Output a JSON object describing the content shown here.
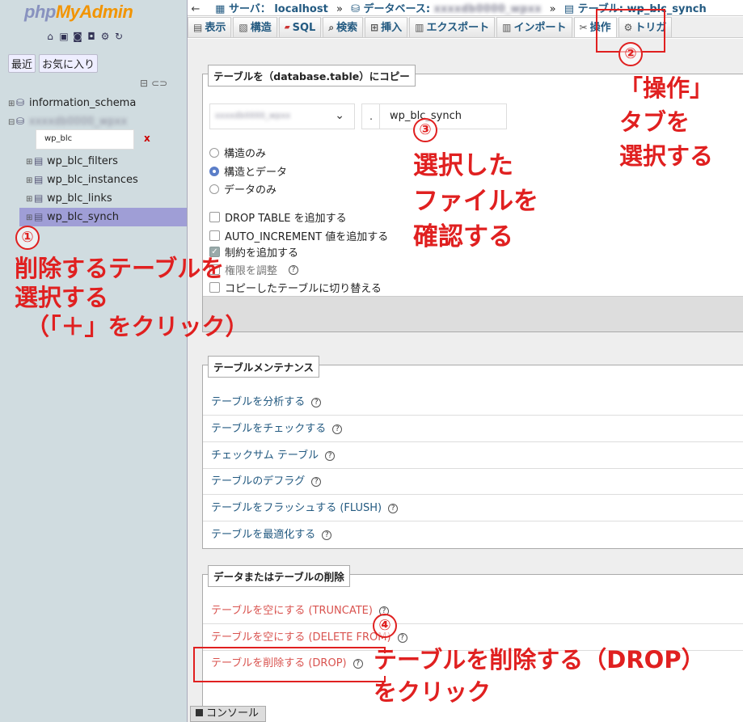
{
  "nav": {
    "logo_php": "php",
    "logo_myadmin": "MyAdmin",
    "tab_recent": "最近",
    "tab_favorites": "お気に入り",
    "databases": [
      {
        "name": "information_schema"
      },
      {
        "name": "xxxxdb0000_wpxx"
      }
    ],
    "filter_value": "wp_blc",
    "filter_clear": "x",
    "tables": [
      "wp_blc_filters",
      "wp_blc_instances",
      "wp_blc_links",
      "wp_blc_synch"
    ]
  },
  "breadcrumb": {
    "server_label": "サーバ： localhost",
    "db_label": "データベース:",
    "db_name": "xxxxdb0000_wpxx",
    "table_label": "テーブル: wp_blc_synch"
  },
  "tabs": [
    {
      "label": "表示",
      "icon": "browse-icon"
    },
    {
      "label": "構造",
      "icon": "structure-icon"
    },
    {
      "label": "SQL",
      "icon": "sql-icon"
    },
    {
      "label": "検索",
      "icon": "search-icon"
    },
    {
      "label": "挿入",
      "icon": "insert-icon"
    },
    {
      "label": "エクスポート",
      "icon": "export-icon"
    },
    {
      "label": "インポート",
      "icon": "import-icon"
    },
    {
      "label": "操作",
      "icon": "operations-icon"
    },
    {
      "label": "トリガ",
      "icon": "triggers-icon"
    }
  ],
  "copy_panel": {
    "legend": "テーブルを（database.table）にコピー",
    "db_value": "xxxxdb0000_wpxx",
    "dot": ".",
    "table_value": "wp_blc_synch",
    "radios": [
      {
        "label": "構造のみ",
        "checked": false
      },
      {
        "label": "構造とデータ",
        "checked": true
      },
      {
        "label": "データのみ",
        "checked": false
      }
    ],
    "checks": [
      {
        "label": "DROP TABLE を追加する",
        "checked": false
      },
      {
        "label": "AUTO_INCREMENT 値を追加する",
        "checked": false
      },
      {
        "label": "制約を追加する",
        "checked": true
      },
      {
        "label": "権限を調整",
        "checked": false
      },
      {
        "label": "コピーしたテーブルに切り替える",
        "checked": false
      }
    ],
    "help": "?"
  },
  "maintenance": {
    "legend": "テーブルメンテナンス",
    "links": [
      "テーブルを分析する",
      "テーブルをチェックする",
      "チェックサム テーブル",
      "テーブルのデフラグ",
      "テーブルをフラッシュする (FLUSH)",
      "テーブルを最適化する"
    ]
  },
  "delete_panel": {
    "legend": "データまたはテーブルの削除",
    "links": [
      "テーブルを空にする (TRUNCATE)",
      "テーブルを空にする (DELETE FROM)",
      "テーブルを削除する (DROP)"
    ]
  },
  "console_label": "コンソール",
  "annotations": {
    "n1": "①",
    "n2": "②",
    "n3": "③",
    "n4": "④",
    "step1": [
      "削除するテーブルを",
      "選択する",
      "（「＋」をクリック）"
    ],
    "step2": [
      "「操作」",
      "タブを",
      "選択する"
    ],
    "step3": [
      "選択した",
      "ファイルを",
      "確認する"
    ],
    "step4": [
      "テーブルを削除する（DROP）",
      "をクリック"
    ]
  },
  "colors": {
    "accent": "#235a81",
    "annotation": "#e02020",
    "active_row": "#9f9ed6",
    "danger": "#d9534f"
  }
}
